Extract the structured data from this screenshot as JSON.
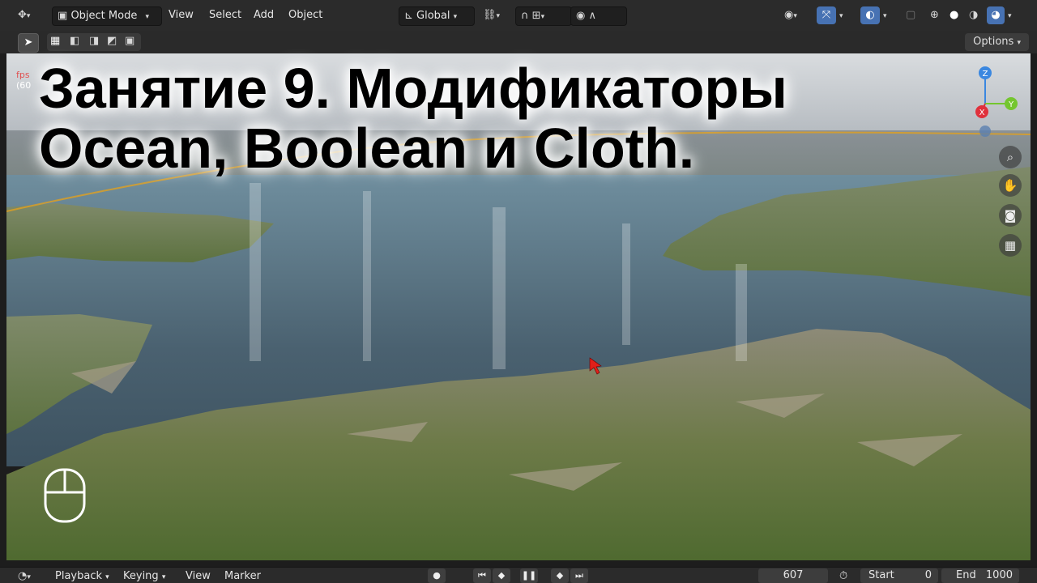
{
  "header": {
    "mode_label": "Object Mode",
    "menus": [
      "View",
      "Select",
      "Add",
      "Object"
    ],
    "transform_orientation": "Global",
    "options_label": "Options"
  },
  "viewport": {
    "fps_label": "fps",
    "fps_value": "(60"
  },
  "overlay_title": {
    "line1": "Занятие 9. Модификаторы",
    "line2": "Ocean, Boolean и Cloth."
  },
  "gizmo": {
    "z": "Z",
    "y": "Y",
    "x": "X"
  },
  "timeline": {
    "menus": [
      "Playback",
      "Keying",
      "View",
      "Marker"
    ],
    "current_frame": "607",
    "start_label": "Start",
    "start_value": "0",
    "end_label": "End",
    "end_value": "1000"
  },
  "colors": {
    "header_bg": "#2b2b2b",
    "accent_blue": "#4772b3",
    "axis_x": "#e0313c",
    "axis_y": "#74c62f",
    "axis_z": "#3a87e0"
  }
}
